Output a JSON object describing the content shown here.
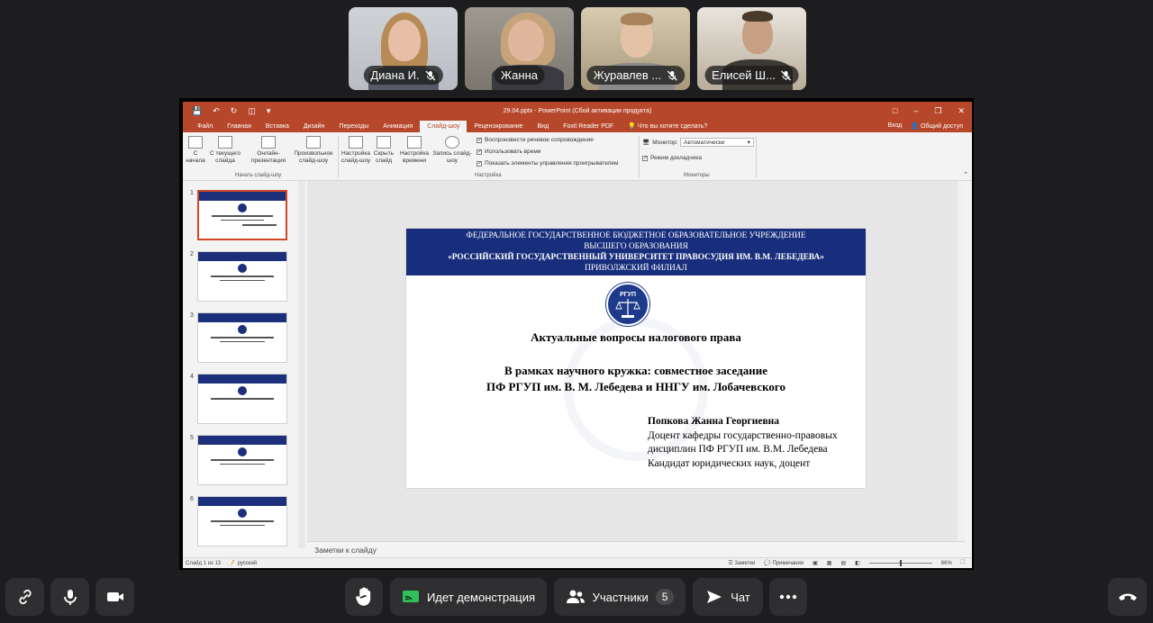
{
  "participants": [
    {
      "name": "Диана И.",
      "muted": true
    },
    {
      "name": "Жанна",
      "muted": false
    },
    {
      "name": "Журавлев ...",
      "muted": true
    },
    {
      "name": "Елисей Ш...",
      "muted": true
    }
  ],
  "ppt": {
    "window_title": "29.04.pptx - PowerPoint (Сбой активации продукта)",
    "tabs": [
      "Файл",
      "Главная",
      "Вставка",
      "Дизайн",
      "Переходы",
      "Анимация",
      "Слайд-шоу",
      "Рецензирование",
      "Вид",
      "Foxit Reader PDF"
    ],
    "active_tab": "Слайд-шоу",
    "tell_me": "Что вы хотите сделать?",
    "signin": "Вход",
    "share": "Общий доступ",
    "ribbon": {
      "from_start": "С начала",
      "from_current": "С текущего слайда",
      "online": "Онлайн-презентация",
      "custom": "Произвольное слайд-шоу",
      "setup": "Настройка слайд-шоу",
      "hide": "Скрыть слайд",
      "timings": "Настройка времени",
      "record": "Запись слайд-шоу",
      "group_start": "Начать слайд-шоу",
      "cb_narration": "Воспроизвести речевое сопровождение",
      "cb_timings": "Использовать время",
      "cb_controls": "Показать элементы управления проигрывателем",
      "group_setup": "Настройка",
      "monitor_label": "Монитор:",
      "monitor_value": "Автоматически",
      "presenter_view": "Режим докладчика",
      "group_monitors": "Мониторы"
    },
    "slide_numbers": [
      "1",
      "2",
      "3",
      "4",
      "5",
      "6"
    ],
    "slide": {
      "header_line1": "ФЕДЕРАЛЬНОЕ ГОСУДАРСТВЕННОЕ БЮДЖЕТНОЕ  ОБРАЗОВАТЕЛЬНОЕ УЧРЕЖДЕНИЕ",
      "header_line2": "ВЫСШЕГО ОБРАЗОВАНИЯ",
      "header_line3": "«РОССИЙСКИЙ ГОСУДАРСТВЕННЫЙ УНИВЕРСИТЕТ ПРАВОСУДИЯ ИМ. В.М. ЛЕБЕДЕВА»",
      "header_line4": "ПРИВОЛЖСКИЙ ФИЛИАЛ",
      "emblem_text": "РГУП",
      "title": "Актуальные вопросы налогового права",
      "subtitle_line1": "В рамках научного кружка: совместное заседание",
      "subtitle_line2": "ПФ РГУП им. В. М. Лебедева и ННГУ им. Лобачевского",
      "author_name": "Попкова Жанна Георгиевна",
      "author_line2": "Доцент кафедры государственно-правовых",
      "author_line3": "дисциплин ПФ РГУП им. В.М. Лебедева",
      "author_line4": "Кандидат юридических наук, доцент"
    },
    "notes_placeholder": "Заметки к слайду",
    "status": {
      "slide_count": "Слайд 1 из 13",
      "language": "русский",
      "notes": "Заметки",
      "comments": "Примечания",
      "zoom": "66%"
    }
  },
  "toolbar": {
    "demo_label": "Идет демонстрация",
    "participants_label": "Участники",
    "participants_count": "5",
    "chat_label": "Чат"
  }
}
